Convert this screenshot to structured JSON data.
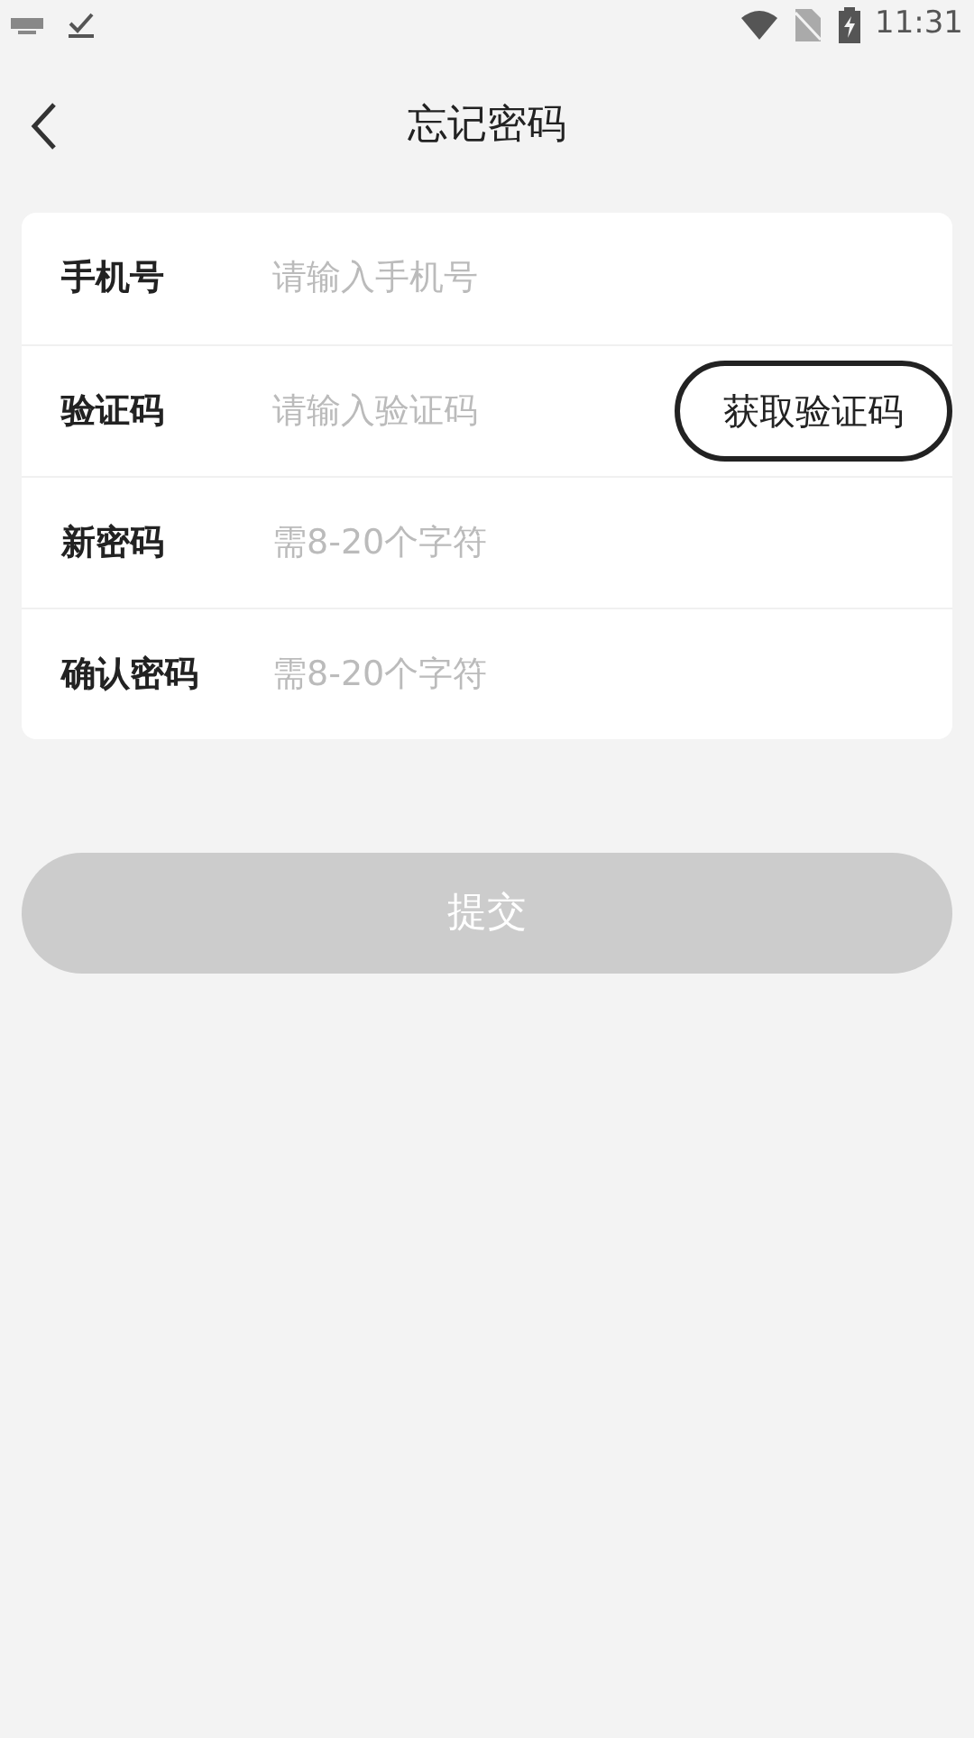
{
  "status_bar": {
    "time": "11:31"
  },
  "header": {
    "title": "忘记密码"
  },
  "fields": [
    {
      "label": "手机号",
      "placeholder": "请输入手机号"
    },
    {
      "label": "验证码",
      "placeholder": "请输入验证码",
      "action_button": "获取验证码"
    },
    {
      "label": "新密码",
      "placeholder": "需8-20个字符"
    },
    {
      "label": "确认密码",
      "placeholder": "需8-20个字符"
    }
  ],
  "submit": {
    "label": "提交",
    "disabled": true
  }
}
